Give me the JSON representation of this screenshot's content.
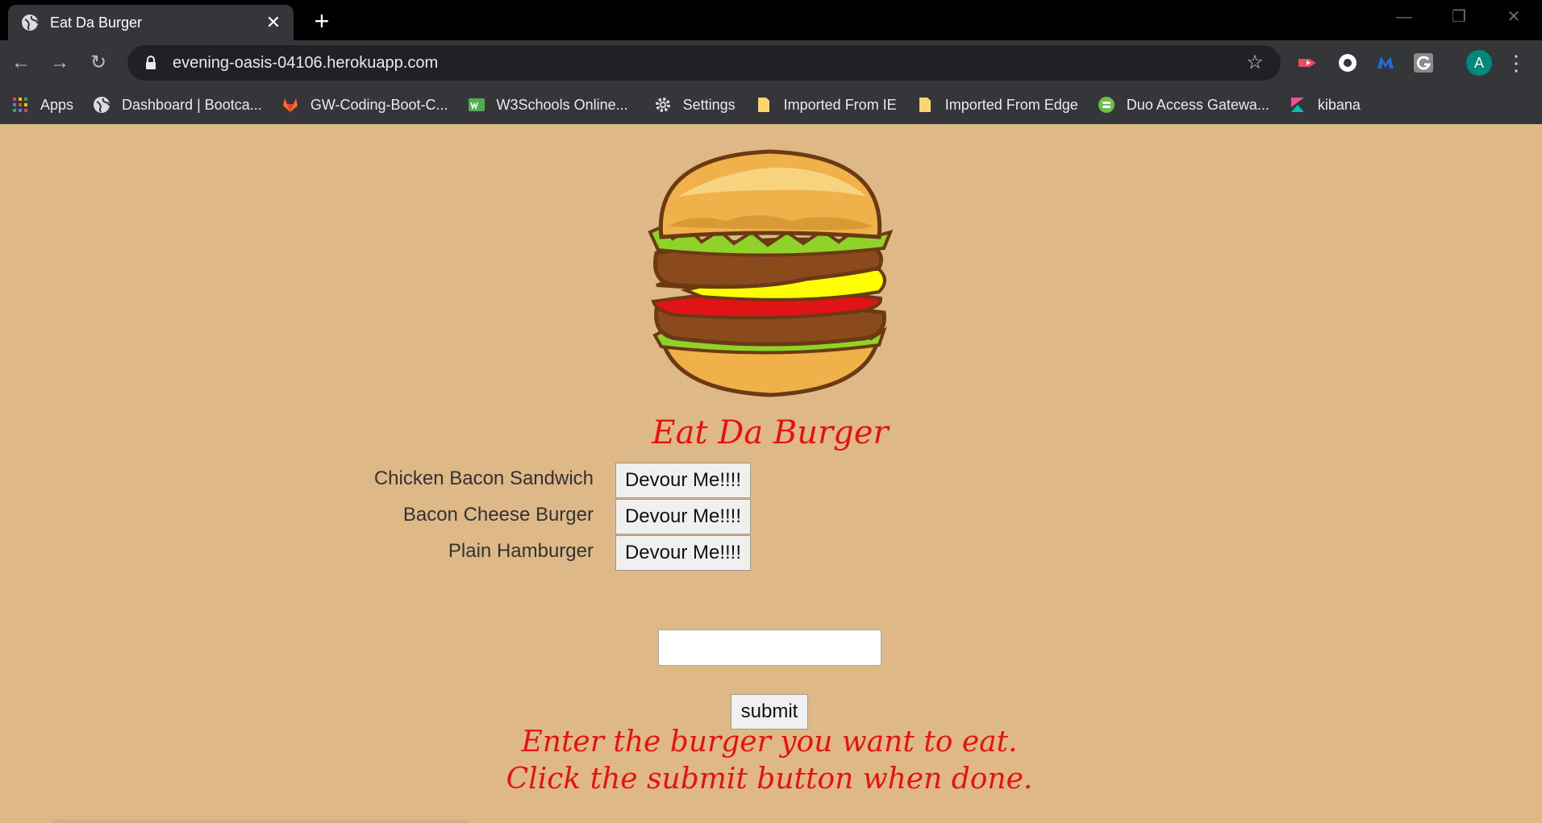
{
  "browser": {
    "tab_title": "Eat Da Burger",
    "url": "evening-oasis-04106.herokuapp.com",
    "avatar_letter": "A",
    "bookmarks": [
      {
        "label": "Apps",
        "icon": "apps-grid-icon"
      },
      {
        "label": "Dashboard | Bootca...",
        "icon": "globe-icon"
      },
      {
        "label": "GW-Coding-Boot-C...",
        "icon": "gitlab-icon"
      },
      {
        "label": "W3Schools Online...",
        "icon": "w3schools-icon"
      },
      {
        "label": "Settings",
        "icon": "gear-icon"
      },
      {
        "label": "Imported From IE",
        "icon": "folder-icon"
      },
      {
        "label": "Imported From Edge",
        "icon": "folder-icon"
      },
      {
        "label": "Duo Access Gatewa...",
        "icon": "duo-icon"
      },
      {
        "label": "kibana",
        "icon": "kibana-icon"
      }
    ]
  },
  "page": {
    "title": "Eat Da Burger",
    "burgers": [
      {
        "name": "Chicken Bacon Sandwich",
        "button_label": "Devour Me!!!!"
      },
      {
        "name": "Bacon Cheese Burger",
        "button_label": "Devour Me!!!!"
      },
      {
        "name": "Plain Hamburger",
        "button_label": "Devour Me!!!!"
      }
    ],
    "input_value": "",
    "submit_label": "submit",
    "instructions_line1": "Enter the burger you want to eat.",
    "instructions_line2": "Click the submit button when done."
  },
  "colors": {
    "page_background": "#deb887",
    "title_red": "#e8120c",
    "avatar_teal": "#00897b"
  }
}
